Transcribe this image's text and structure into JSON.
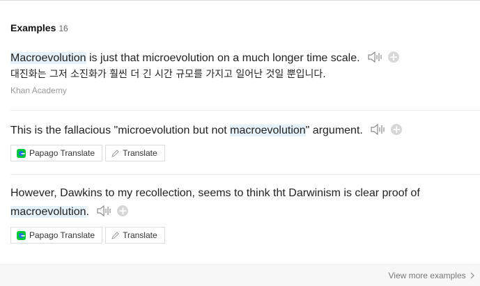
{
  "section": {
    "title": "Examples",
    "count": "16"
  },
  "examples": [
    {
      "pre": "",
      "highlight": "Macroevolution",
      "post": " is just that microevolution on a much longer time scale.",
      "translation": "대진화는 그저 소진화가 훨씬 더 긴 시간 규모를 가지고 일어난 것일 뿐입니다.",
      "source": "Khan Academy"
    },
    {
      "pre": "This is the fallacious \"microevolution but not ",
      "highlight": "macroevolution",
      "post": "\" argument."
    },
    {
      "line1": "However, Dawkins to my recollection, seems to think tht Darwinism is clear proof of",
      "highlight": "macroevolution",
      "post": "."
    }
  ],
  "buttons": {
    "papago": "Papago Translate",
    "translate": "Translate"
  },
  "footer": {
    "more": "View more examples"
  },
  "colors": {
    "highlight": "#e5f1fb",
    "icon": "#8a8a8a",
    "plus": "#d7d7d7"
  },
  "icons": {
    "speaker": "speaker-icon",
    "plus": "add-icon",
    "papago": "papago-logo-icon",
    "pen": "pen-icon",
    "chevron": "chevron-right-icon"
  }
}
